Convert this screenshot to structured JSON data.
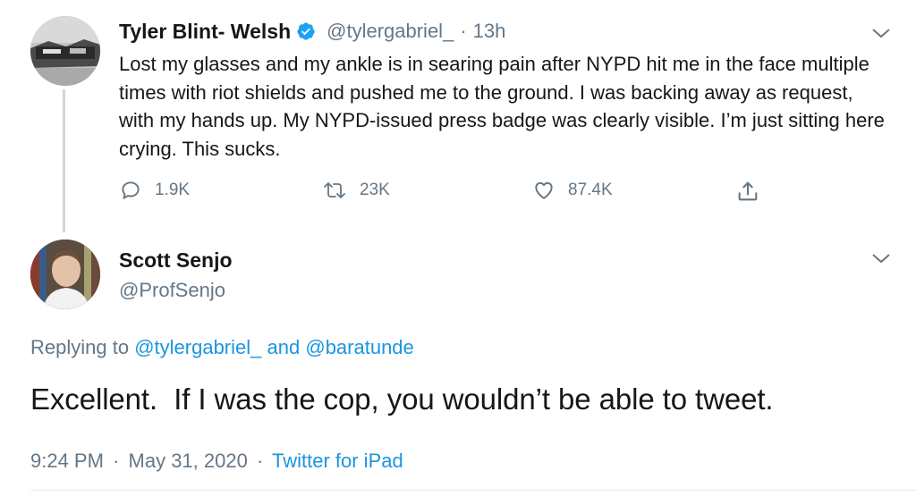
{
  "parent_tweet": {
    "display_name": "Tyler Blint- Welsh",
    "handle": "@tylergabriel_",
    "separator": "·",
    "time_ago": "13h",
    "text": "Lost my glasses and my ankle is in searing pain after NYPD hit me in the face multiple times with riot shields and pushed me to the ground. I was backing away as request, with my hands up. My NYPD-issued press badge was clearly visible. I’m just sitting here crying. This sucks.",
    "replies": "1.9K",
    "retweets": "23K",
    "likes": "87.4K"
  },
  "reply_tweet": {
    "display_name": "Scott Senjo",
    "handle": "@ProfSenjo",
    "replying_prefix": "Replying to",
    "replying_user1": "@tylergabriel_",
    "replying_and": "and",
    "replying_user2": "@baratunde",
    "text": "Excellent.  If I was the cop, you wouldn’t be able to tweet.",
    "time": "9:24 PM",
    "date": "May 31, 2020",
    "dot": "·",
    "source": "Twitter for iPad"
  },
  "colors": {
    "accent": "#1b95e0",
    "muted": "#657786",
    "text": "#14171a",
    "verified": "#1da1f2"
  },
  "icons": [
    "reply-icon",
    "retweet-icon",
    "like-icon",
    "share-icon",
    "verified-badge-icon",
    "chevron-down-icon"
  ]
}
